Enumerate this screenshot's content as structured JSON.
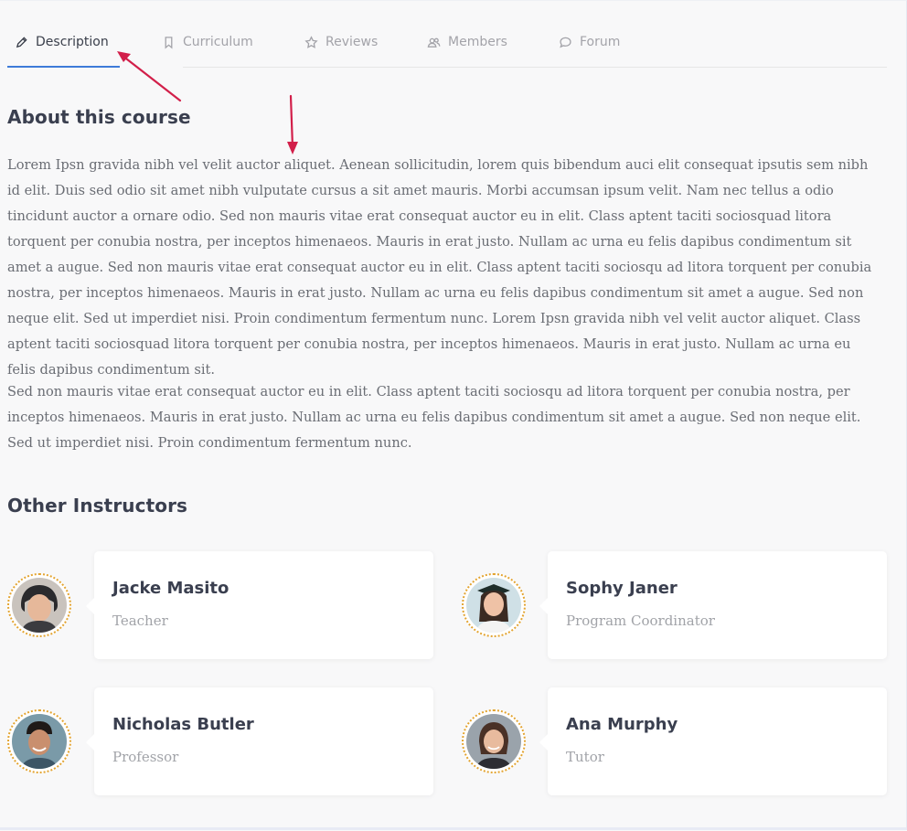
{
  "tabs": [
    {
      "label": "Description",
      "icon": "pencil-icon",
      "active": true
    },
    {
      "label": "Curriculum",
      "icon": "bookmark-icon",
      "active": false
    },
    {
      "label": "Reviews",
      "icon": "star-icon",
      "active": false
    },
    {
      "label": "Members",
      "icon": "users-icon",
      "active": false
    },
    {
      "label": "Forum",
      "icon": "chat-bubble-icon",
      "active": false
    }
  ],
  "about": {
    "title": "About this course",
    "paragraphs": [
      "Lorem Ipsn gravida nibh vel velit auctor aliquet. Aenean sollicitudin, lorem quis bibendum auci elit consequat ipsutis sem nibh id elit. Duis sed odio sit amet nibh vulputate cursus a sit amet mauris. Morbi accumsan ipsum velit. Nam nec tellus a odio tincidunt auctor a ornare odio. Sed non mauris vitae erat consequat auctor eu in elit. Class aptent taciti sociosquad litora torquent per conubia nostra, per inceptos himenaeos. Mauris in erat justo. Nullam ac urna eu felis dapibus condimentum sit amet a augue. Sed non mauris vitae erat consequat auctor eu in elit. Class aptent taciti sociosqu ad litora torquent per conubia nostra, per inceptos himenaeos. Mauris in erat justo. Nullam ac urna eu felis dapibus condimentum sit amet a augue. Sed non neque elit. Sed ut imperdiet nisi. Proin condimentum fermentum nunc. Lorem Ipsn gravida nibh vel velit auctor aliquet. Class aptent taciti sociosquad litora torquent per conubia nostra, per inceptos himenaeos. Mauris in erat justo. Nullam ac urna eu felis dapibus condimentum sit.",
      "Sed non mauris vitae erat consequat auctor eu in elit. Class aptent taciti sociosqu ad litora torquent per conubia nostra, per inceptos himenaeos. Mauris in erat justo. Nullam ac urna eu felis dapibus condimentum sit amet a augue. Sed non neque elit. Sed ut imperdiet nisi. Proin condimentum fermentum nunc."
    ]
  },
  "instructors": {
    "title": "Other Instructors",
    "items": [
      {
        "name": "Jacke Masito",
        "role": "Teacher"
      },
      {
        "name": "Sophy Janer",
        "role": "Program Coordinator"
      },
      {
        "name": "Nicholas Butler",
        "role": "Professor"
      },
      {
        "name": "Ana Murphy",
        "role": "Tutor"
      }
    ]
  },
  "colors": {
    "accent": "#3e7bd9",
    "heading": "#3a3f4f",
    "body_text": "#6a6d74",
    "avatar_ring": "#e3a431",
    "annotation_arrow": "#d21f4a"
  }
}
